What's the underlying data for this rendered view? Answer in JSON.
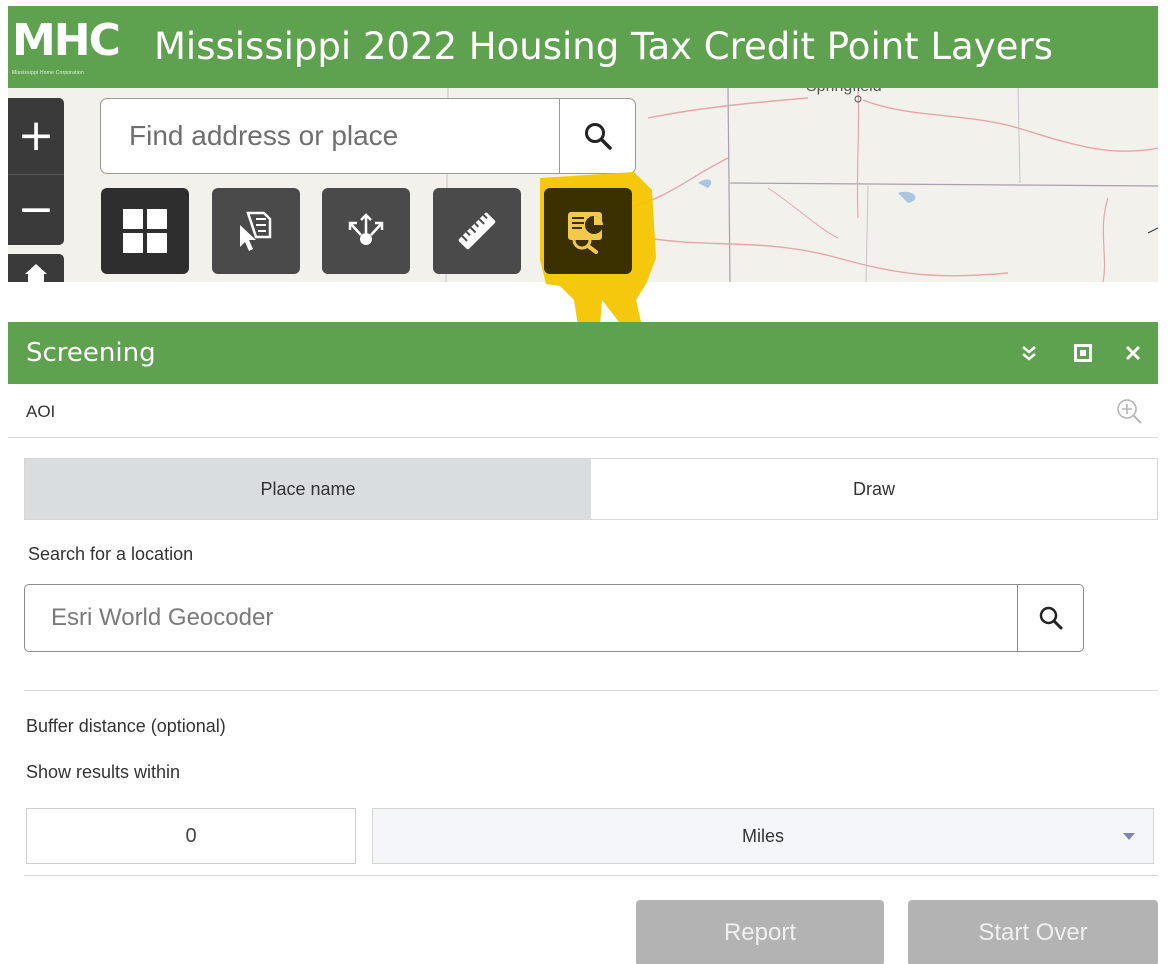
{
  "header": {
    "logo_text": "MHC",
    "logo_subtext": "Mississippi Home Corporation",
    "title": "Mississippi 2022 Housing Tax Credit Point Layers",
    "background_color": "#5ea14f"
  },
  "map": {
    "city_label": "Springfield",
    "zoom_in_label": "+",
    "zoom_out_label": "−",
    "home_icon": "home-icon",
    "search": {
      "placeholder": "Find address or place",
      "icon": "search-icon"
    },
    "toolbar": [
      {
        "name": "layout-grid-tool",
        "icon": "grid-icon",
        "active": false
      },
      {
        "name": "select-tool",
        "icon": "select-cursor-icon",
        "active": false
      },
      {
        "name": "share-tool",
        "icon": "share-arrows-icon",
        "active": false
      },
      {
        "name": "measure-tool",
        "icon": "ruler-icon",
        "active": false
      },
      {
        "name": "screening-tool",
        "icon": "screening-report-icon",
        "active": true
      }
    ],
    "highlight_color": "#f6c500"
  },
  "panel": {
    "title": "Screening",
    "header_icons": [
      "collapse-icon",
      "maximize-icon",
      "close-icon"
    ],
    "aoi_label": "AOI",
    "aoi_icon": "zoom-in-icon",
    "tabs": [
      {
        "label": "Place name",
        "active": true
      },
      {
        "label": "Draw",
        "active": false
      }
    ],
    "search_label": "Search for a location",
    "geocoder_placeholder": "Esri World Geocoder",
    "buffer_label": "Buffer distance (optional)",
    "within_label": "Show results within",
    "distance_value": "0",
    "unit_selected": "Miles",
    "report_label": "Report",
    "start_over_label": "Start Over",
    "button_disabled_color": "#b3b3b3"
  }
}
